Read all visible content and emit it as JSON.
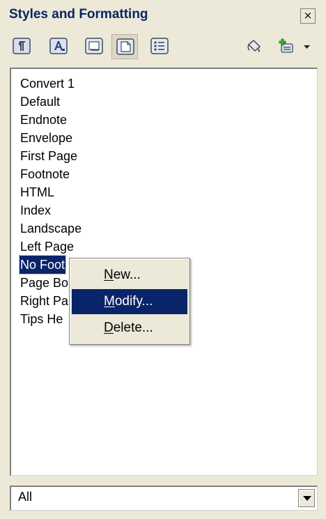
{
  "panel": {
    "title": "Styles and Formatting",
    "close_glyph": "×"
  },
  "toolbar": {
    "buttons": [
      {
        "name": "paragraph-styles-icon"
      },
      {
        "name": "character-styles-icon"
      },
      {
        "name": "frame-styles-icon"
      },
      {
        "name": "page-styles-icon",
        "pressed": true
      },
      {
        "name": "list-styles-icon"
      },
      {
        "name": "fill-format-mode-icon"
      },
      {
        "name": "new-style-from-selection-icon"
      }
    ],
    "dropdown_icon": "chevron-down-icon"
  },
  "style_list": {
    "items": [
      "Convert 1",
      "Default",
      "Endnote",
      "Envelope",
      "First Page",
      "Footnote",
      "HTML",
      "Index",
      "Landscape",
      "Left Page",
      "No Foot",
      "Page Bo",
      "Right Pa",
      "Tips He"
    ],
    "selected_index": 10
  },
  "context_menu": {
    "items": [
      {
        "mnemonic": "N",
        "rest": "ew..."
      },
      {
        "mnemonic": "M",
        "rest": "odify...",
        "active": true
      },
      {
        "mnemonic": "D",
        "rest": "elete..."
      }
    ]
  },
  "filter": {
    "value": "All"
  },
  "colors": {
    "panel_bg": "#ece9d8",
    "title_text": "#0a2466",
    "selection": "#0a246a"
  }
}
